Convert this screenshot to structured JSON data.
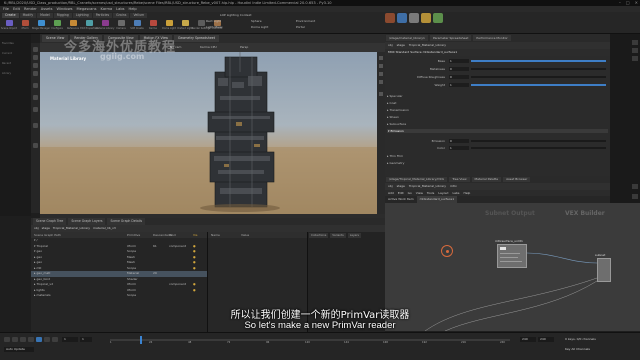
{
  "window": {
    "title": "K:/RBL/2020/USD_Class_production/RBL_Cranefo/scenes/usd_structures/Rebe/scene Files/RBL/USD_structure_Rebe_v007.hip.hip - Houdini Indie Limited-Commercial 20.0.653 - Py3.10"
  },
  "menubar": [
    "File",
    "Edit",
    "Render",
    "Assets",
    "Windows",
    "Megascans",
    "Karma",
    "Labs",
    "Help"
  ],
  "shelf": {
    "tabs": [
      "Create",
      "Modify",
      "Model",
      "Rigging",
      "Lighting",
      "Particles",
      "Grains",
      "Vellum"
    ],
    "tools": [
      {
        "label": "Scene Import",
        "color": "#6a5ec2"
      },
      {
        "label": "Xform",
        "color": "#b04e3a"
      },
      {
        "label": "Stage Manager",
        "color": "#3f8fd0"
      },
      {
        "label": "Configure",
        "color": "#5d9f52"
      },
      {
        "label": "Reference",
        "color": "#c68a36"
      },
      {
        "label": "Edit Properties",
        "color": "#4f9fa6"
      },
      {
        "label": "Material Library",
        "color": "#8a3b8e"
      },
      {
        "label": "Camera",
        "color": "#6b6b6b"
      },
      {
        "label": "SOP Create",
        "color": "#4d7db6"
      },
      {
        "label": "Karma",
        "color": "#b8493e"
      },
      {
        "label": "Dome Light",
        "color": "#caa03a"
      },
      {
        "label": "Distant Light",
        "color": "#c7a94a"
      },
      {
        "label": "Render Settings",
        "color": "#5c5c5c"
      },
      {
        "label": "USD ROP",
        "color": "#9c7047"
      }
    ],
    "context": {
      "label": "LOP Lighting Context",
      "items": [
        "Rect Light",
        "Sphere",
        "Environment",
        "Light Mixer",
        "Dome Light",
        "Portal"
      ]
    }
  },
  "viewport": {
    "tabs": [
      "Scene View",
      "Render Gallery",
      "Composite View",
      "Motion FX View",
      "Geometry Spreadsheet"
    ],
    "title": "Material Library",
    "camera_label": "No cam",
    "renderer": "Karma CPU",
    "header_badge": "Persp"
  },
  "watermark": {
    "cn": "今多海外优质教程",
    "domain": "ggiig.com"
  },
  "params": {
    "tabs": [
      "/stage/material_library1",
      "Parameter Spreadsheet",
      "Performance Monitor"
    ],
    "path": [
      "obj",
      "stage",
      "Tropical_Material_Library"
    ],
    "node_title": "MtlX Standard Surface  mtlxstandard_surface1",
    "rows": [
      {
        "label": "Base",
        "value": "1",
        "fill": 1.0
      },
      {
        "label": "Metalness",
        "value": "0",
        "fill": 0.0
      },
      {
        "label": "Diffuse Roughness",
        "value": "0",
        "fill": 0.0
      },
      {
        "label": "Weight",
        "value": "1",
        "fill": 1.0
      }
    ],
    "folders": [
      "Specular",
      "Coat",
      "Transmission",
      "Sheen",
      "Subsurface",
      "Emission",
      "Thin Film",
      "Geometry"
    ],
    "emission_rows": [
      {
        "label": "Emission",
        "value": "0"
      },
      {
        "label": "Color",
        "value": "1"
      }
    ]
  },
  "network": {
    "tabs": [
      "/stage/Tropical_Material_Library/mtlx",
      "Tree View",
      "Material Palette",
      "Asset Browser"
    ],
    "path": [
      "obj",
      "stage",
      "Tropical_Material_Library",
      "mtlx"
    ],
    "menu": [
      "Add",
      "Edit",
      "Go",
      "View",
      "Tools",
      "Layout",
      "Labs",
      "Help"
    ],
    "sub": [
      "Active Work Item",
      "mtlxstandard_surface1"
    ],
    "context_label": "Subnet Output",
    "builder_label": "VEX Builder",
    "nodes": [
      {
        "title": "mtlxsurface_unlit1"
      },
      {
        "title": "subnet"
      }
    ]
  },
  "scene_graph": {
    "tabs": [
      "Scene Graph Tree",
      "Scene Graph Layers",
      "Scene Graph Details"
    ],
    "path": [
      "obj",
      "stage",
      "Tropical_Material_Library",
      "material_lib_v3"
    ],
    "headers": [
      "Scene Graph Path",
      "Primitive",
      "Descendants",
      "Kind",
      "Vis"
    ],
    "rows": [
      {
        "name": "▾ /",
        "prim": "",
        "desc": "",
        "kind": "",
        "vis": ""
      },
      {
        "name": "  ▾ Tropical",
        "prim": "Xform",
        "desc": "61",
        "kind": "component",
        "vis": "●"
      },
      {
        "name": "    ▾ geo",
        "prim": "Scope",
        "desc": "",
        "kind": "",
        "vis": "●"
      },
      {
        "name": "      ▸ geo",
        "prim": "Mesh",
        "desc": "",
        "kind": "",
        "vis": "●"
      },
      {
        "name": "      ▸ geo",
        "prim": "Mesh",
        "desc": "",
        "kind": "",
        "vis": "●"
      },
      {
        "name": "    ▸ mtl",
        "prim": "Scope",
        "desc": "",
        "kind": "",
        "vis": "●"
      },
      {
        "name": "      ▸ geo_matl",
        "prim": "Material",
        "desc": "29",
        "kind": "",
        "vis": ""
      },
      {
        "name": "      ▸ geo_bind",
        "prim": "Shader",
        "desc": "",
        "kind": "",
        "vis": ""
      },
      {
        "name": "  ▸ Tropical_v2",
        "prim": "Xform",
        "desc": "",
        "kind": "component",
        "vis": "●"
      },
      {
        "name": "  ▸ lights",
        "prim": "Xform",
        "desc": "",
        "kind": "",
        "vis": "●"
      },
      {
        "name": "  ▸ materials",
        "prim": "Scope",
        "desc": "",
        "kind": "",
        "vis": ""
      }
    ],
    "selected_row": 6,
    "prop_headers": [
      "Name",
      "Value"
    ],
    "tree_tabs": [
      "Collections",
      "Variants",
      "Layers"
    ]
  },
  "timeline": {
    "current_frame": "1",
    "start": "1",
    "end": "240",
    "range_end": "240",
    "ticks": [
      "1",
      "24",
      "48",
      "72",
      "96",
      "120",
      "144",
      "168",
      "192",
      "216",
      "240"
    ],
    "status": "Auto Update",
    "key_label": "0 keys, 0/0 channels",
    "key_all": "Key All Channels"
  },
  "left_sidebar": [
    "Favorites",
    "Current",
    "Recent",
    "Library"
  ],
  "subtitles": {
    "cn": "所以让我们创建一个新的PrimVar读取器",
    "en": "So let's make a new PrimVar reader"
  },
  "colors": {
    "accent": "#3e7ec6",
    "selection": "#46525e",
    "cursor": "#d86a3c"
  }
}
